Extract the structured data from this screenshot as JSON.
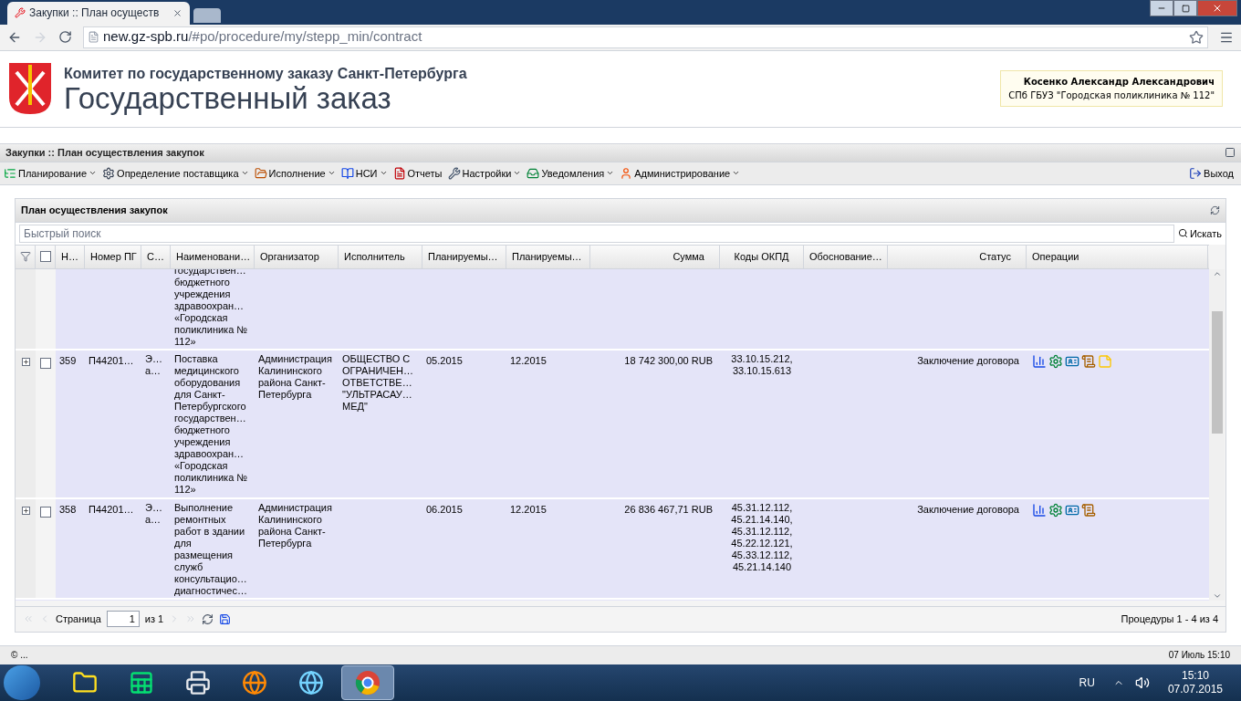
{
  "browser": {
    "tab_title": "Закупки :: План осуществ",
    "url_host": "new.gz-spb.ru",
    "url_path": "/#po/procedure/my/stepp_min/contract"
  },
  "header": {
    "subtitle": "Комитет по государственному заказу Санкт-Петербурга",
    "title": "Государственный заказ",
    "user_name": "Косенко Александр Александрович",
    "user_org": "СПб ГБУЗ \"Городская поликлиника № 112\""
  },
  "page_title": "Закупки :: План осуществления закупок",
  "menu": [
    {
      "label": "Планирование",
      "dropdown": true
    },
    {
      "label": "Определение поставщика",
      "dropdown": true
    },
    {
      "label": "Исполнение",
      "dropdown": true
    },
    {
      "label": "НСИ",
      "dropdown": true
    },
    {
      "label": "Отчеты",
      "dropdown": false
    },
    {
      "label": "Настройки",
      "dropdown": true
    },
    {
      "label": "Уведомления",
      "dropdown": true
    },
    {
      "label": "Администрирование",
      "dropdown": true
    }
  ],
  "select_all_checked": false,
  "logout": "Выход",
  "panel": {
    "title": "План осуществления закупок",
    "search_placeholder": "Быстрый поиск",
    "search_button": "Искать"
  },
  "columns": [
    "Н…",
    "Номер ПГ",
    "С…",
    "Наименовани…",
    "Организатор",
    "Исполнитель",
    "Планируемы…",
    "Планируемы…",
    "Сумма",
    "Коды ОКПД",
    "Обоснование…",
    "Статус",
    "Операции"
  ],
  "rows": [
    {
      "name": "государствен…\nбюджетного\nучреждения\nздравоохран…\n«Городская\nполиклиника №\n112»"
    },
    {
      "expandable": true,
      "checked": false,
      "number": "359",
      "pg_number": "П44201…",
      "column_3": "Э…\nа…",
      "name": "Поставка\nмедицинского\nоборудования\nдля Санкт-\nПетербургского\nгосударствен…\nбюджетного\nучреждения\nздравоохран…\n«Городская\nполиклиника №\n112»",
      "organizer": "Администрация\nКалининского\nрайона Санкт-\nПетербурга",
      "executor": "ОБЩЕСТВО С\nОГРАНИЧЕН…\nОТВЕТСТВЕ…\n\"УЛЬТРАСАУ…\nМЕД\"",
      "planned_1": "05.2015",
      "planned_2": "12.2015",
      "sum": "18 742 300,00 RUB",
      "okpd": "33.10.15.212,\n33.10.15.613",
      "status": "Заключение договора",
      "actions": true,
      "note": true
    },
    {
      "expandable": true,
      "checked": false,
      "number": "358",
      "pg_number": "П44201…",
      "column_3": "Э…\nа…",
      "name": "Выполнение\nремонтных\nработ в здании\nдля\nразмещения\nслужб\nконсультацио…\nдиагностичес…",
      "organizer": "Администрация\nКалининского\nрайона Санкт-\nПетербурга",
      "planned_1": "06.2015",
      "planned_2": "12.2015",
      "sum": "26 836 467,71 RUB",
      "okpd": "45.31.12.112,\n45.21.14.140,\n45.31.12.112,\n45.22.12.121,\n45.33.12.112,\n45.21.14.140",
      "status": "Заключение договора",
      "actions": true,
      "note": false
    }
  ],
  "paging": {
    "page_label": "Страница",
    "page": "1",
    "of": "из 1",
    "summary": "Процедуры 1 - 4 из 4"
  },
  "status_bar": {
    "left": "© ...",
    "right": "07 Июль 15:10"
  },
  "taskbar": {
    "apps": [
      {
        "kind": "explorer",
        "selected": false
      },
      {
        "kind": "excel",
        "selected": false
      },
      {
        "kind": "printer",
        "selected": false
      },
      {
        "kind": "firefox",
        "selected": false
      },
      {
        "kind": "ie",
        "selected": false
      },
      {
        "kind": "chrome",
        "selected": true
      }
    ],
    "lang": "RU",
    "time": "15:10",
    "date": "07.07.2015"
  }
}
